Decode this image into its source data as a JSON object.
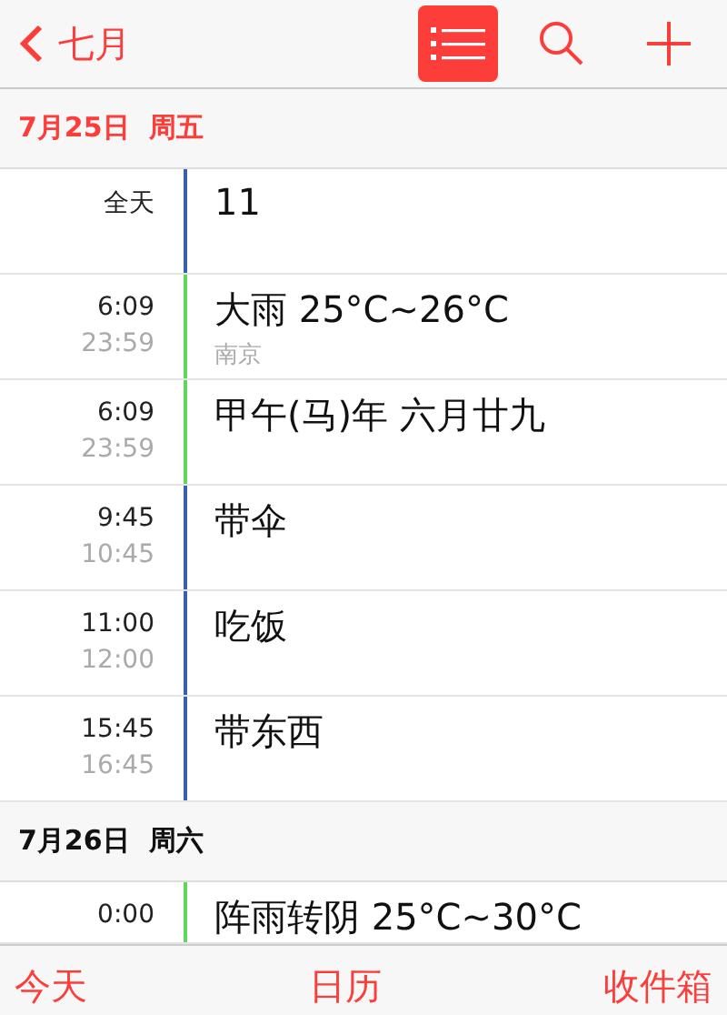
{
  "nav": {
    "back_label": "七月",
    "list_view_selected": true
  },
  "days": [
    {
      "date": "7月25日",
      "weekday": "周五",
      "today": true,
      "events": [
        {
          "start": "全天",
          "title": "11",
          "color": "#3a5fb0"
        },
        {
          "start": "6:09",
          "end": "23:59",
          "title": "大雨 25°C~26°C",
          "location": "南京",
          "color": "#5ed85a"
        },
        {
          "start": "6:09",
          "end": "23:59",
          "title": "甲午(马)年 六月廿九",
          "color": "#5ed85a"
        },
        {
          "start": "9:45",
          "end": "10:45",
          "title": "带伞",
          "color": "#3a5fb0"
        },
        {
          "start": "11:00",
          "end": "12:00",
          "title": "吃饭",
          "color": "#3a5fb0"
        },
        {
          "start": "15:45",
          "end": "16:45",
          "title": "带东西",
          "color": "#3a5fb0"
        }
      ]
    },
    {
      "date": "7月26日",
      "weekday": "周六",
      "today": false,
      "events": [
        {
          "start": "0:00",
          "title": "阵雨转阴 25°C~30°C",
          "color": "#5ed85a"
        }
      ]
    }
  ],
  "toolbar": [
    "今天",
    "日历",
    "收件箱"
  ]
}
